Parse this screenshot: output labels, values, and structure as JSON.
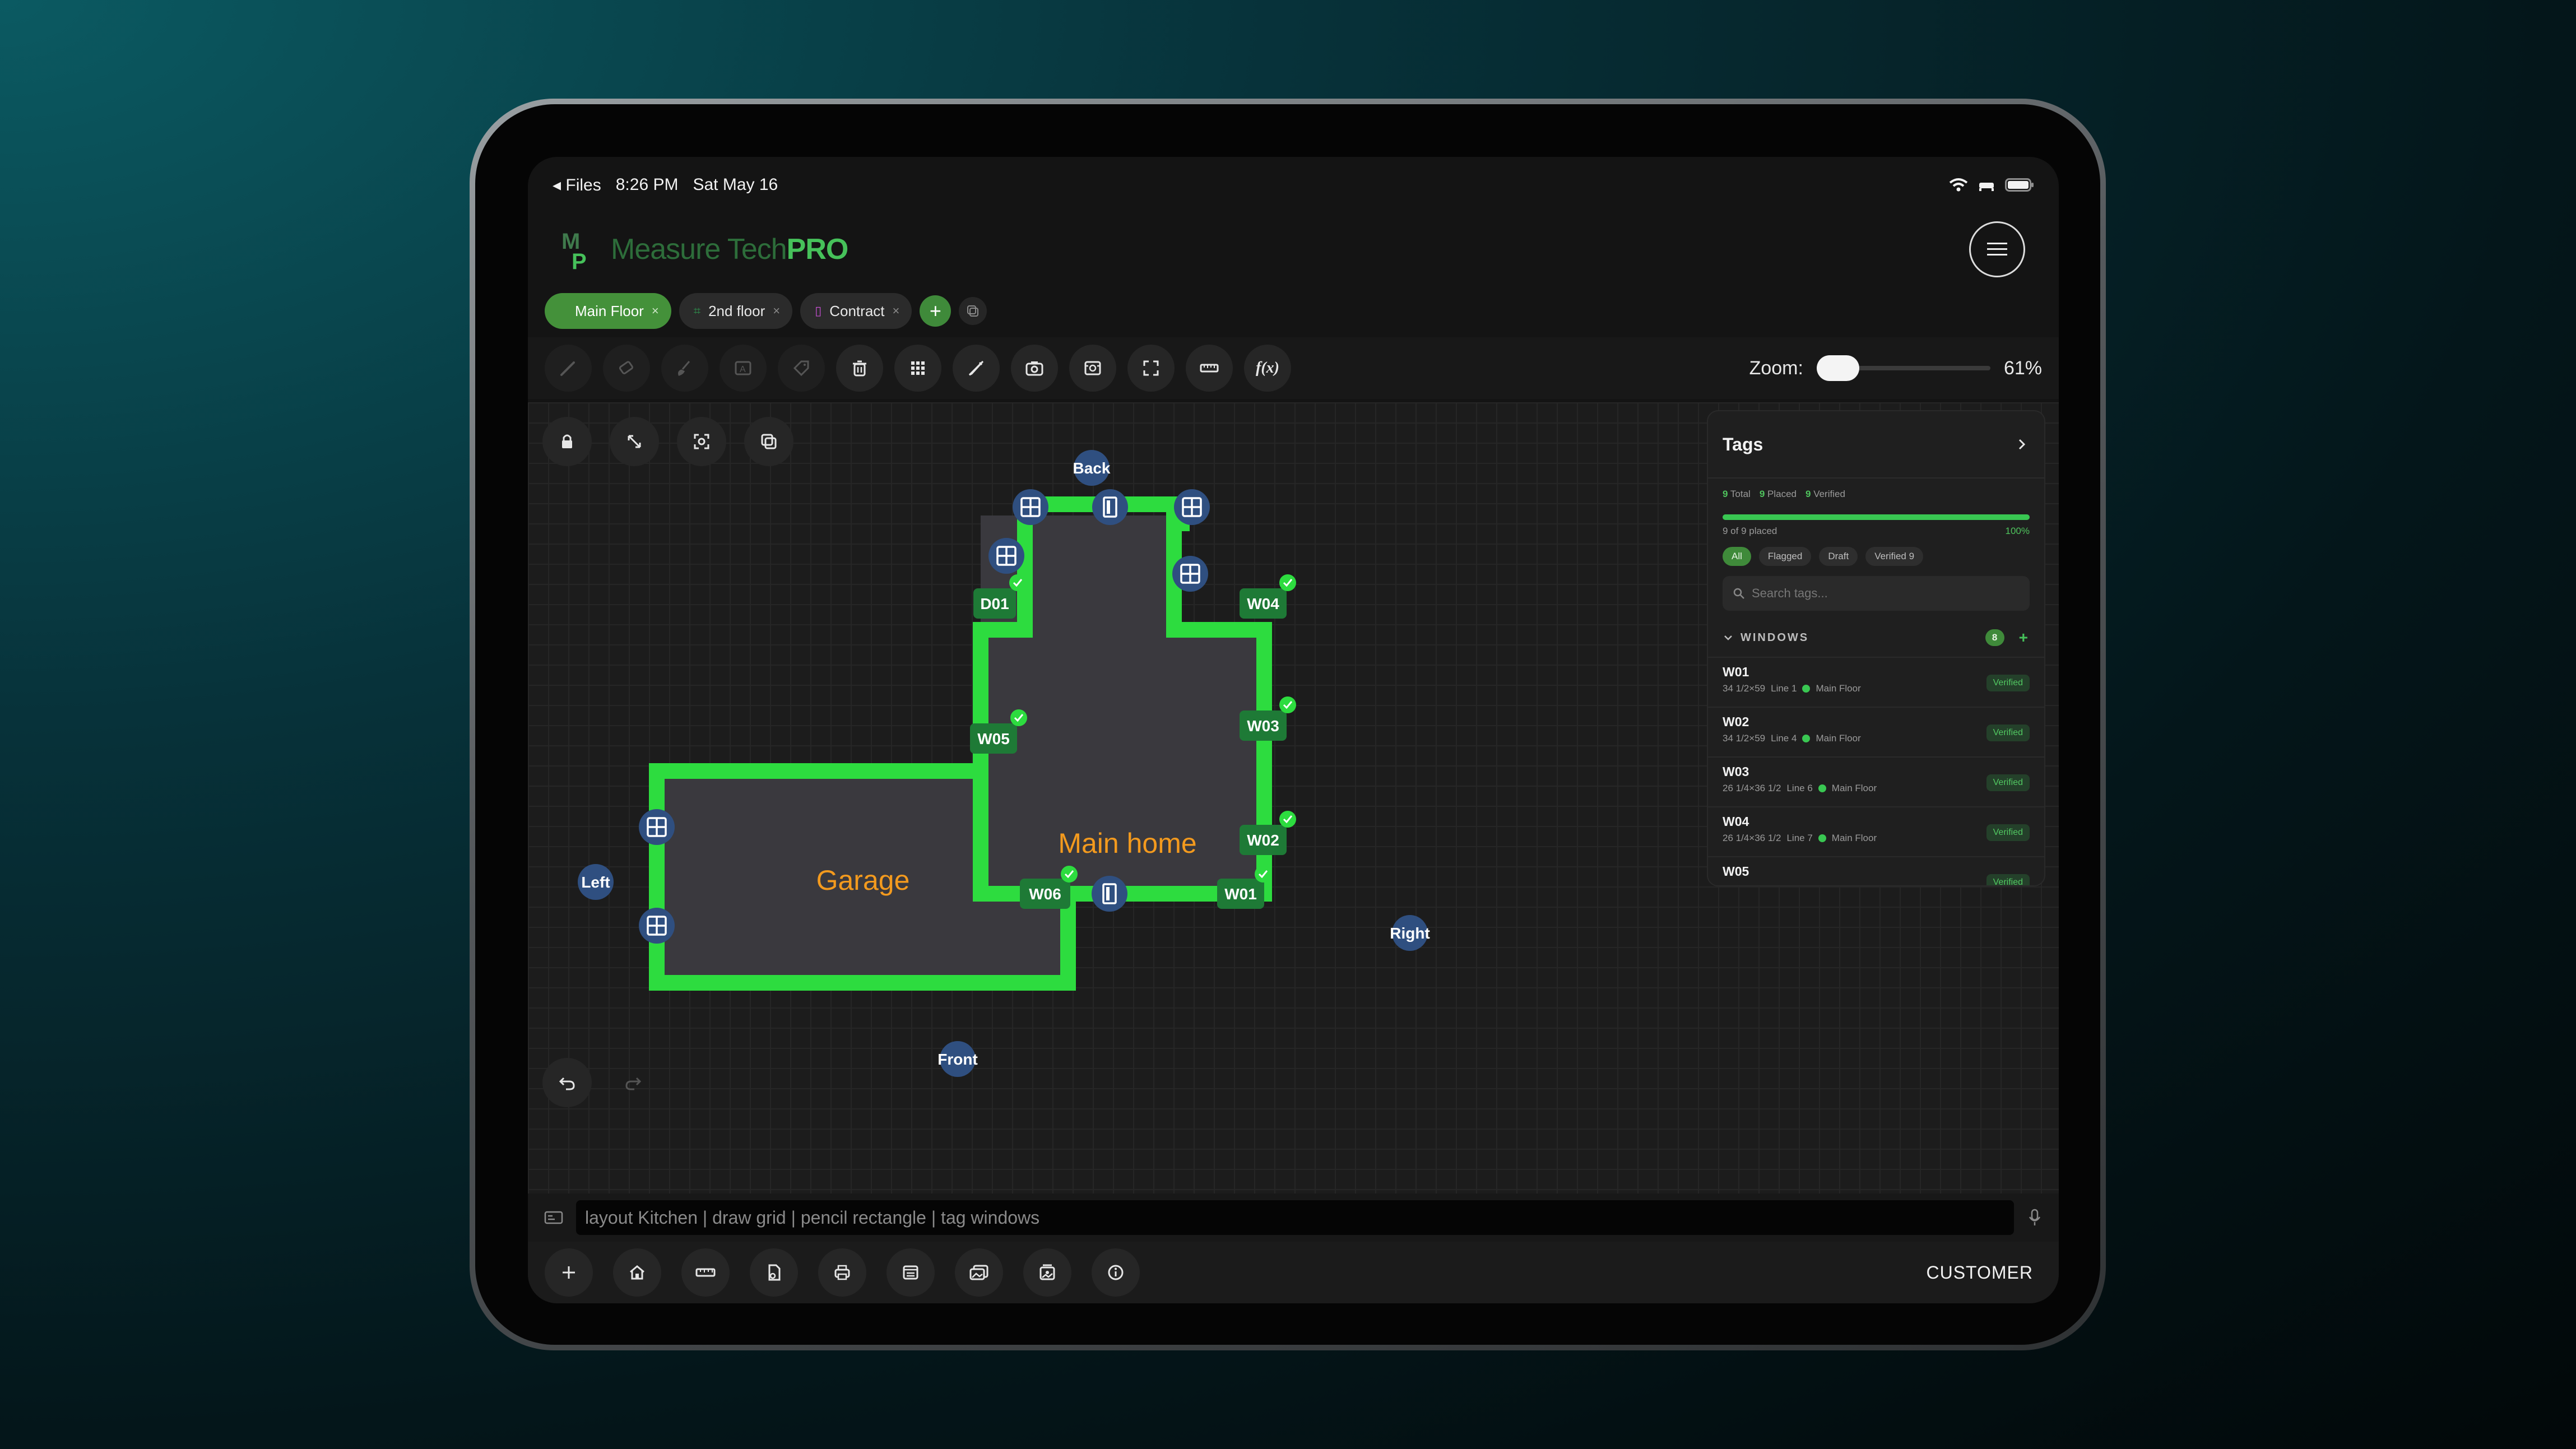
{
  "status_bar": {
    "back": "Files",
    "time": "8:26 PM",
    "date": "Sat May 16"
  },
  "header": {
    "logo_mark": "MP",
    "brand_main": "Measure Tech",
    "brand_pro": "PRO"
  },
  "tabs": [
    {
      "label": "Main Floor",
      "active": true
    },
    {
      "label": "2nd floor",
      "active": false
    },
    {
      "label": "Contract",
      "active": false
    }
  ],
  "toolbar": {
    "tools": [
      "pencil-icon",
      "eraser-icon",
      "brush-icon",
      "text-box-icon",
      "tag-icon",
      "trash-icon",
      "grid-icon",
      "ruler-pen-icon",
      "camera-icon",
      "photo-scan-icon",
      "fullscreen-icon",
      "measure-tape-icon",
      "function-icon"
    ],
    "function_label": "f(x)",
    "zoom_label": "Zoom:",
    "zoom_value": "61%",
    "zoom_fraction": 0.0
  },
  "canvas": {
    "rooms": [
      {
        "name": "Garage"
      },
      {
        "name": "Main home"
      }
    ],
    "directions": {
      "back": "Back",
      "front": "Front",
      "left": "Left",
      "right": "Right"
    },
    "tags": [
      "D01",
      "W04",
      "W05",
      "W03",
      "W02",
      "W06",
      "W01"
    ],
    "colors": {
      "wall": "#2ddc3f",
      "room_fill": "#3a393e",
      "marker": "#2f4f80",
      "tag": "#1e7a36",
      "room_label": "#f39a1e"
    }
  },
  "tags_panel": {
    "title": "Tags",
    "total_value": "9",
    "total_label": "Total",
    "placed_value": "9",
    "placed_label": "Placed",
    "verified_value": "9",
    "verified_label": "Verified",
    "progress_text": "9 of 9 placed",
    "progress_pct": "100%",
    "progress_fraction": 1.0,
    "filters": [
      "All",
      "Flagged",
      "Draft",
      "Verified 9"
    ],
    "search_placeholder": "Search tags...",
    "group_name": "WINDOWS",
    "group_count": "8",
    "rows": [
      {
        "id": "W01",
        "size": "34 1/2×59",
        "line": "Line 1",
        "floor": "Main Floor",
        "status": "Verified"
      },
      {
        "id": "W02",
        "size": "34 1/2×59",
        "line": "Line 4",
        "floor": "Main Floor",
        "status": "Verified"
      },
      {
        "id": "W03",
        "size": "26 1/4×36 1/2",
        "line": "Line 6",
        "floor": "Main Floor",
        "status": "Verified"
      },
      {
        "id": "W04",
        "size": "26 1/4×36 1/2",
        "line": "Line 7",
        "floor": "Main Floor",
        "status": "Verified"
      },
      {
        "id": "W05",
        "size": "",
        "line": "",
        "floor": "",
        "status": "Verified"
      }
    ]
  },
  "command_bar": {
    "placeholder": "layout Kitchen | draw grid | pencil rectangle | tag windows"
  },
  "bottom_bar": {
    "customer_label": "CUSTOMER"
  }
}
